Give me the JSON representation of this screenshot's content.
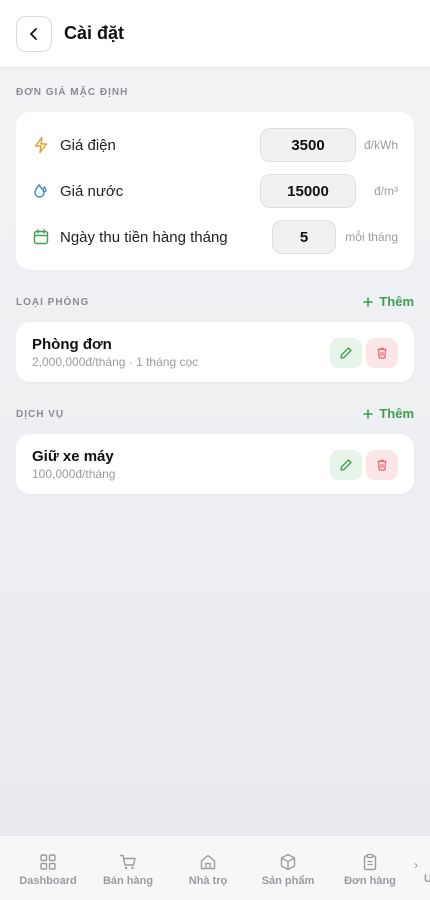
{
  "header": {
    "title": "Cài đặt",
    "back_icon": "chevron-left-icon"
  },
  "default_prices": {
    "title": "ĐƠN GIÁ MẶC ĐỊNH",
    "items": [
      {
        "icon": "lightning-icon",
        "label": "Giá điện",
        "value": "3500",
        "unit": "đ/kWh"
      },
      {
        "icon": "water-drop-icon",
        "label": "Giá nước",
        "value": "15000",
        "unit": "đ/m³"
      },
      {
        "icon": "calendar-icon",
        "label": "Ngày thu tiền hàng tháng",
        "value": "5",
        "unit": "mỗi tháng"
      }
    ]
  },
  "room_types": {
    "title": "LOẠI PHÒNG",
    "add_label": "Thêm",
    "items": [
      {
        "name": "Phòng đơn",
        "sub": "2,000,000đ/tháng · 1 tháng cọc"
      }
    ]
  },
  "services": {
    "title": "DỊCH VỤ",
    "add_label": "Thêm",
    "items": [
      {
        "name": "Giữ xe máy",
        "sub": "100,000đ/tháng"
      }
    ]
  },
  "nav": {
    "items": [
      {
        "icon": "grid-icon",
        "label": "Dashboard"
      },
      {
        "icon": "cart-icon",
        "label": "Bán hàng"
      },
      {
        "icon": "house-icon",
        "label": "Nhà trọ"
      },
      {
        "icon": "box-icon",
        "label": "Sản phẩm"
      },
      {
        "icon": "clipboard-icon",
        "label": "Đơn hàng"
      }
    ],
    "more_glyph": "›",
    "cut_label": "Ư"
  },
  "colors": {
    "accent_green": "#3f9e52",
    "danger_red": "#e06a72",
    "lightning": "#e0a22a",
    "water": "#3a86c8",
    "calendar": "#3f9e52"
  }
}
